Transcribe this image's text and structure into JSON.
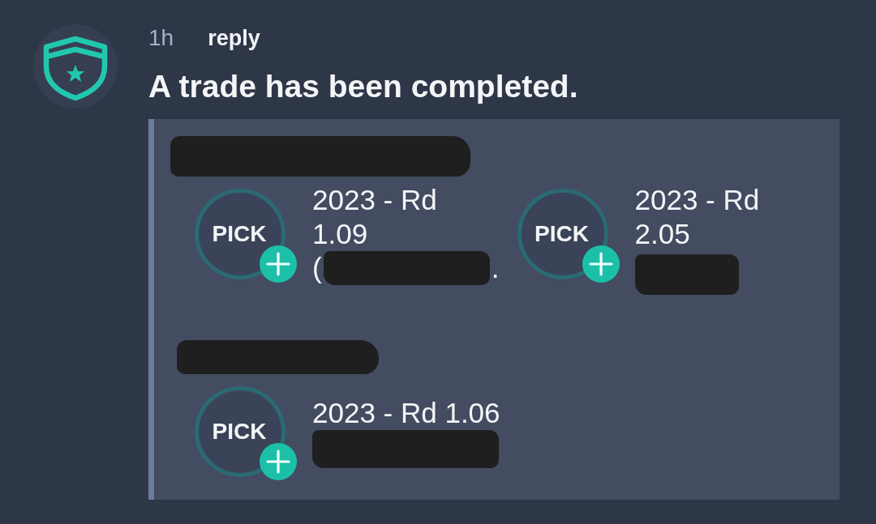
{
  "message": {
    "time": "1h",
    "action": "reply",
    "text": "A trade has been completed."
  },
  "trade": {
    "groups": [
      {
        "name_redacted": true,
        "picks": [
          {
            "badge": "PICK",
            "title": "2023 - Rd 1.09",
            "detail_prefix": "(",
            "detail_redacted": true,
            "detail_suffix": "."
          },
          {
            "badge": "PICK",
            "title": "2023 - Rd 2.05",
            "detail_redacted": true
          }
        ]
      },
      {
        "name_redacted": true,
        "picks": [
          {
            "badge": "PICK",
            "title": "2023 - Rd 1.06",
            "detail_redacted": true
          }
        ]
      }
    ]
  }
}
